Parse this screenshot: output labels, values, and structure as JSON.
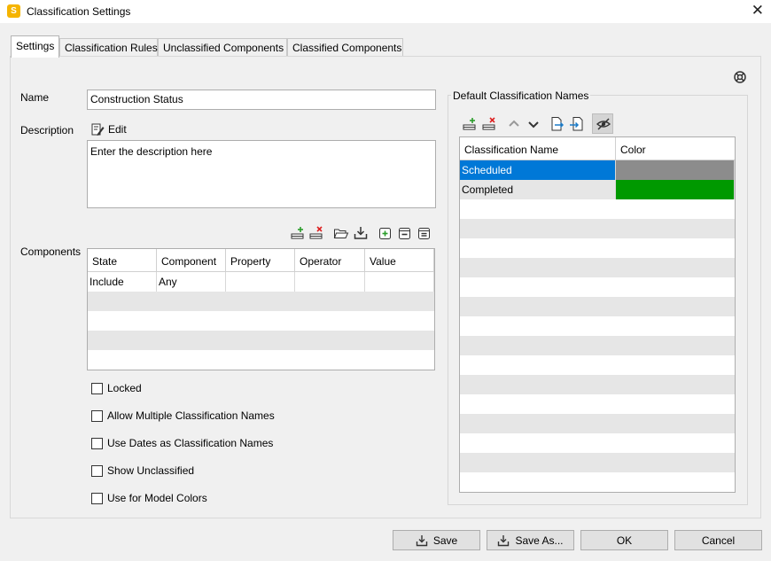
{
  "window": {
    "title": "Classification Settings",
    "app_icon_letter": "S"
  },
  "tabs": [
    "Settings",
    "Classification Rules",
    "Unclassified Components",
    "Classified Components"
  ],
  "settings": {
    "name_label": "Name",
    "name_value": "Construction Status",
    "description_label": "Description",
    "edit_label": "Edit",
    "description_value": "Enter the description here",
    "components_label": "Components",
    "components_columns": [
      "State",
      "Component",
      "Property",
      "Operator",
      "Value"
    ],
    "components_rows": [
      [
        "Include",
        "Any",
        "",
        "",
        ""
      ]
    ],
    "checkboxes": [
      {
        "label": "Locked",
        "checked": false
      },
      {
        "label": "Allow Multiple Classification Names",
        "checked": false
      },
      {
        "label": "Use Dates as Classification Names",
        "checked": false
      },
      {
        "label": "Show Unclassified",
        "checked": false
      },
      {
        "label": "Use for Model Colors",
        "checked": false
      }
    ]
  },
  "default_names": {
    "title": "Default Classification Names",
    "columns": [
      "Classification Name",
      "Color"
    ],
    "rows": [
      {
        "name": "Scheduled",
        "color": "#8c8c8c",
        "selected": true
      },
      {
        "name": "Completed",
        "color": "#009900",
        "selected": false
      }
    ]
  },
  "colors": {
    "selection": "#0078d7"
  },
  "footer": {
    "save": "Save",
    "save_as": "Save As...",
    "ok": "OK",
    "cancel": "Cancel"
  }
}
